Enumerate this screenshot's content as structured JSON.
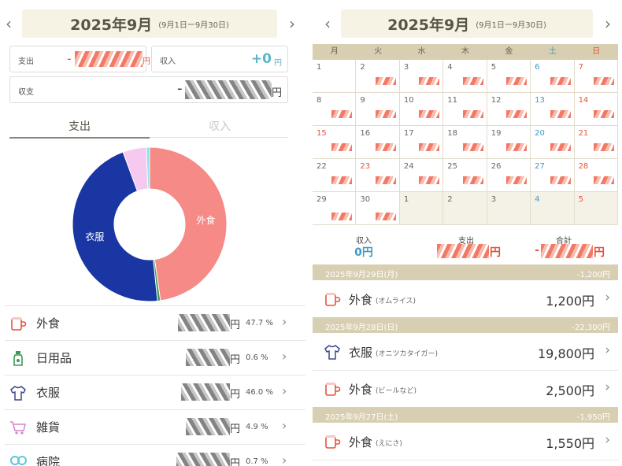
{
  "left": {
    "month_title": "2025年9月",
    "month_range": "(9月1日ー9月30日)",
    "prev_glyph": "‹",
    "next_glyph": "›",
    "expense_label": "支出",
    "expense_prefix": "-",
    "yen": "円",
    "income_label": "収入",
    "income_value": "+0",
    "balance_label": "収支",
    "balance_prefix": "-",
    "tabs": [
      {
        "label": "支出"
      },
      {
        "label": "収入"
      }
    ],
    "colors": {
      "accent": "#5bb5c9",
      "tab_active": "#5a5347",
      "tab_inactive": "#c9c9c9",
      "tab_line": "#8a8478",
      "red": "#e5533d"
    },
    "donut": {
      "segments": [
        {
          "label": "外食",
          "percent": 47.7,
          "color": "#f58a86"
        },
        {
          "label": "日用品",
          "percent": 0.6,
          "color": "#3a9a55"
        },
        {
          "label": "衣服",
          "percent": 46.0,
          "color": "#1a36a3"
        },
        {
          "label": "雑貨",
          "percent": 4.9,
          "color": "#f5c9f0"
        },
        {
          "label": "病院",
          "percent": 0.7,
          "color": "#8fe0ea"
        }
      ],
      "shown_labels": [
        "外食",
        "衣服"
      ]
    },
    "categories": [
      {
        "name": "外食",
        "pct": "47.7 %",
        "icon": "cup-icon"
      },
      {
        "name": "日用品",
        "pct": "0.6 %",
        "icon": "bottle-icon"
      },
      {
        "name": "衣服",
        "pct": "46.0 %",
        "icon": "shirt-icon"
      },
      {
        "name": "雑貨",
        "pct": "4.9 %",
        "icon": "cart-icon"
      },
      {
        "name": "病院",
        "pct": "0.7 %",
        "icon": "pill-icon"
      }
    ]
  },
  "right": {
    "month_title": "2025年9月",
    "month_range": "(9月1日ー9月30日)",
    "weekdays": [
      "月",
      "火",
      "水",
      "木",
      "金",
      "土",
      "日"
    ],
    "weekday_colors": [
      "#6b6250",
      "#6b6250",
      "#6b6250",
      "#6b6250",
      "#6b6250",
      "#3c9bc7",
      "#e5533d"
    ],
    "weeks": [
      [
        "1",
        "2",
        "3",
        "4",
        "5",
        "6",
        "7"
      ],
      [
        "8",
        "9",
        "10",
        "11",
        "12",
        "13",
        "14"
      ],
      [
        "15",
        "16",
        "17",
        "18",
        "19",
        "20",
        "21"
      ],
      [
        "22",
        "23",
        "24",
        "25",
        "26",
        "27",
        "28"
      ],
      [
        "29",
        "30",
        "1",
        "2",
        "3",
        "4",
        "5"
      ]
    ],
    "summary": {
      "income_label": "収入",
      "income_value": "0円",
      "expense_label": "支出",
      "expense_suffix": "円",
      "total_label": "合計",
      "total_prefix": "-",
      "total_suffix": "円"
    },
    "days": [
      {
        "date": "2025年9月29日(月)",
        "total": "-1,200円",
        "items": [
          {
            "category": "外食",
            "memo": "(オムライス)",
            "amount": "1,200円",
            "icon": "cup-icon"
          }
        ]
      },
      {
        "date": "2025年9月28日(日)",
        "total": "-22,300円",
        "items": [
          {
            "category": "衣服",
            "memo": "(オニツカタイガー)",
            "amount": "19,800円",
            "icon": "shirt-icon"
          },
          {
            "category": "外食",
            "memo": "(ビールなど)",
            "amount": "2,500円",
            "icon": "cup-icon"
          }
        ]
      },
      {
        "date": "2025年9月27日(土)",
        "total": "-1,950円",
        "items": [
          {
            "category": "外食",
            "memo": "(えにさ)",
            "amount": "1,550円",
            "icon": "cup-icon"
          }
        ]
      }
    ]
  }
}
